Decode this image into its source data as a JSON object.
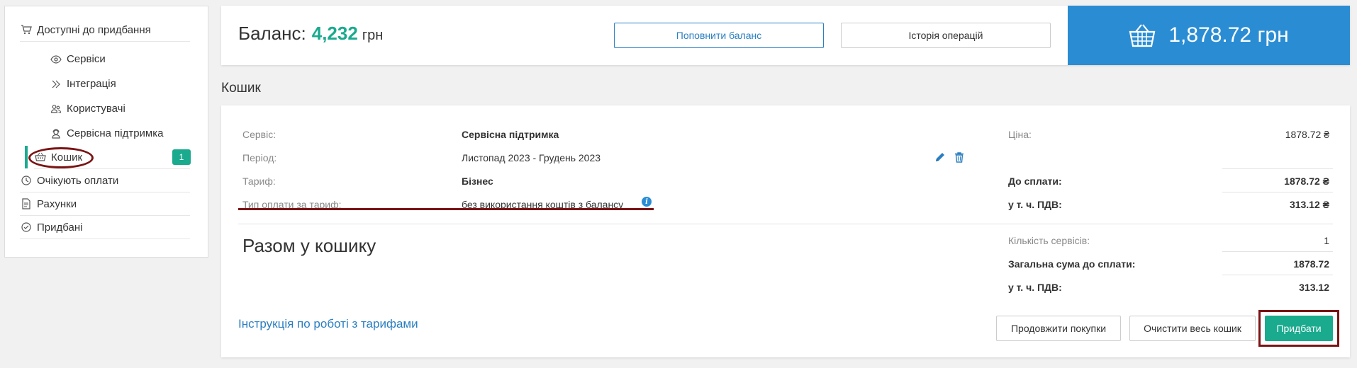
{
  "sidebar": {
    "items": [
      {
        "label": "Доступні до придбання",
        "icon": "cart-icon"
      },
      {
        "label": "Сервіси",
        "icon": "eye-icon"
      },
      {
        "label": "Інтеграція",
        "icon": "integration-icon"
      },
      {
        "label": "Користувачі",
        "icon": "users-icon"
      },
      {
        "label": "Сервісна підтримка",
        "icon": "support-icon"
      },
      {
        "label": "Кошик",
        "icon": "basket-icon",
        "badge": "1",
        "active": true
      },
      {
        "label": "Очікують оплати",
        "icon": "clock-icon"
      },
      {
        "label": "Рахунки",
        "icon": "document-icon"
      },
      {
        "label": "Придбані",
        "icon": "check-circle-icon"
      }
    ]
  },
  "header": {
    "balance_label": "Баланс:",
    "balance_amount": "4,232",
    "balance_currency": "грн",
    "topup_label": "Поповнити баланс",
    "history_label": "Історія операцій",
    "cart_total": "1,878.72 грн"
  },
  "cart": {
    "title": "Кошик",
    "service_label": "Сервіс:",
    "service_value": "Сервісна підтримка",
    "period_label": "Період:",
    "period_value": "Листопад 2023 - Грудень 2023",
    "tariff_label": "Тариф:",
    "tariff_value": "Бізнес",
    "payment_type_label": "Тип оплати за тариф:",
    "payment_type_value": "без використання коштів з балансу",
    "price_label": "Ціна:",
    "price_value": "1878.72 ₴",
    "due_label": "До сплати:",
    "due_value": "1878.72 ₴",
    "vat_label": "у т. ч. ПДВ:",
    "vat_value": "313.12 ₴"
  },
  "summary": {
    "title": "Разом у кошику",
    "count_label": "Кількість сервісів:",
    "count_value": "1",
    "total_label": "Загальна сума до сплати:",
    "total_value": "1878.72",
    "vat_label": "у т. ч. ПДВ:",
    "vat_value": "313.12"
  },
  "actions": {
    "instructions_link": "Інструкція по роботі з тарифами",
    "continue_label": "Продовжити покупки",
    "clear_label": "Очистити весь кошик",
    "buy_label": "Придбати"
  },
  "colors": {
    "accent_green": "#1aaa8e",
    "accent_blue": "#2a8dd4",
    "highlight_red": "#7a1414"
  }
}
